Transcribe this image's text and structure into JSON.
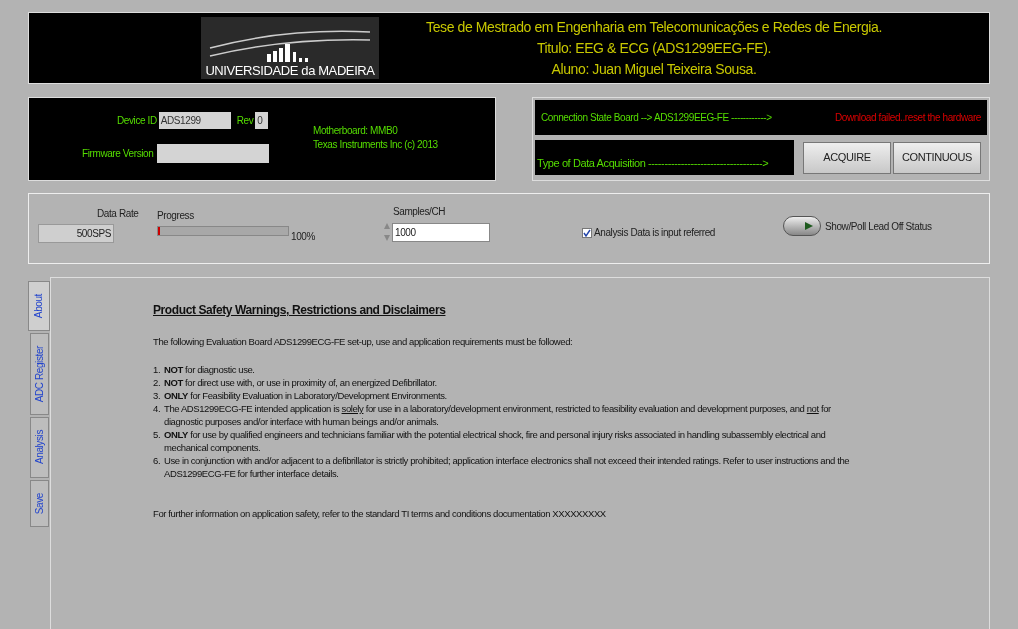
{
  "header": {
    "logo_text": "UNIVERSIDADE da MADEIRA",
    "lines": [
      "Tese de Mestrado em Engenharia em Telecomunicações e Redes de Energia.",
      "Titulo: EEG & ECG (ADS1299EEG-FE).",
      "Aluno: Juan Miguel Teixeira Sousa."
    ]
  },
  "device": {
    "device_id_label": "Device ID",
    "device_id": "ADS1299",
    "rev_label": "Rev",
    "rev": "0",
    "firmware_label": "Firmware Version",
    "motherboard": "Motherboard:  MMB0",
    "copyright": "Texas Instruments Inc (c) 2013"
  },
  "connection": {
    "state_label": "Connection State Board --> ADS1299EEG-FE ------------>",
    "state_message": "Download failed..reset the hardware",
    "acquisition_label": "Type of Data Acquisition ----------------------------------->",
    "buttons": [
      "ACQUIRE",
      "CONTINUOUS"
    ]
  },
  "controls": {
    "data_rate_label": "Data Rate",
    "data_rate": "500SPS",
    "progress_label": "Progress",
    "progress": {
      "level": 0.01,
      "reading": "100%"
    },
    "samples_label": "Samples/CH",
    "samples": "1000",
    "input_referred": {
      "label": "Analysis Data is input referred",
      "checked": true
    },
    "lead_off": {
      "label": "Show/Poll Lead Off Status",
      "on": false
    }
  },
  "tabs": [
    {
      "label": "About",
      "selected": true
    },
    {
      "label": "ADC Register",
      "selected": false
    },
    {
      "label": "Analysis",
      "selected": false
    },
    {
      "label": "Save",
      "selected": false
    }
  ],
  "about": {
    "title": "Product Safety Warnings, Restrictions and Disclaimers",
    "intro": "The following Evaluation Board ADS1299ECG-FE set-up, use and application requirements must be followed:",
    "items": [
      {
        "number": "1.",
        "parts": [
          {
            "text": "NOT",
            "kind": "bold"
          },
          {
            "text": " for diagnostic use.",
            "kind": "plain"
          }
        ]
      },
      {
        "number": "2.",
        "parts": [
          {
            "text": "NOT",
            "kind": "bold"
          },
          {
            "text": " for direct use with, or use in proximity of, an energized Defibrillator.",
            "kind": "plain"
          }
        ]
      },
      {
        "number": "3.",
        "parts": [
          {
            "text": "ONLY",
            "kind": "bold"
          },
          {
            "text": " for Feasibility Evaluation in Laboratory/Development Environments.",
            "kind": "plain"
          }
        ]
      },
      {
        "number": "4.",
        "parts": [
          {
            "text": "The ADS1299ECG-FE intended application is ",
            "kind": "plain"
          },
          {
            "text": "solely",
            "kind": "underline"
          },
          {
            "text": " for use in a laboratory/development environment, restricted to feasibility evaluation and development purposes, and ",
            "kind": "plain"
          },
          {
            "text": "not",
            "kind": "underline"
          },
          {
            "text": " for diagnostic purposes and/or interface with human beings and/or animals.",
            "kind": "plain"
          }
        ]
      },
      {
        "number": "5.",
        "parts": [
          {
            "text": "ONLY",
            "kind": "bold"
          },
          {
            "text": " for use by qualified engineers and technicians familiar with the potential electrical shock, fire and personal injury risks associated in handling subassembly electrical and mechanical components.",
            "kind": "plain"
          }
        ]
      },
      {
        "number": "6.",
        "parts": [
          {
            "text": "Use in conjunction with and/or adjacent to a defibrillator is strictly prohibited; application interface electronics shall not exceed their intended ratings. Refer to user instructions and the ADS1299ECG-FE for further interface details.",
            "kind": "plain"
          }
        ]
      }
    ],
    "footer": "For further information on application safety, refer to the standard TI terms and conditions documentation XXXXXXXXX"
  }
}
